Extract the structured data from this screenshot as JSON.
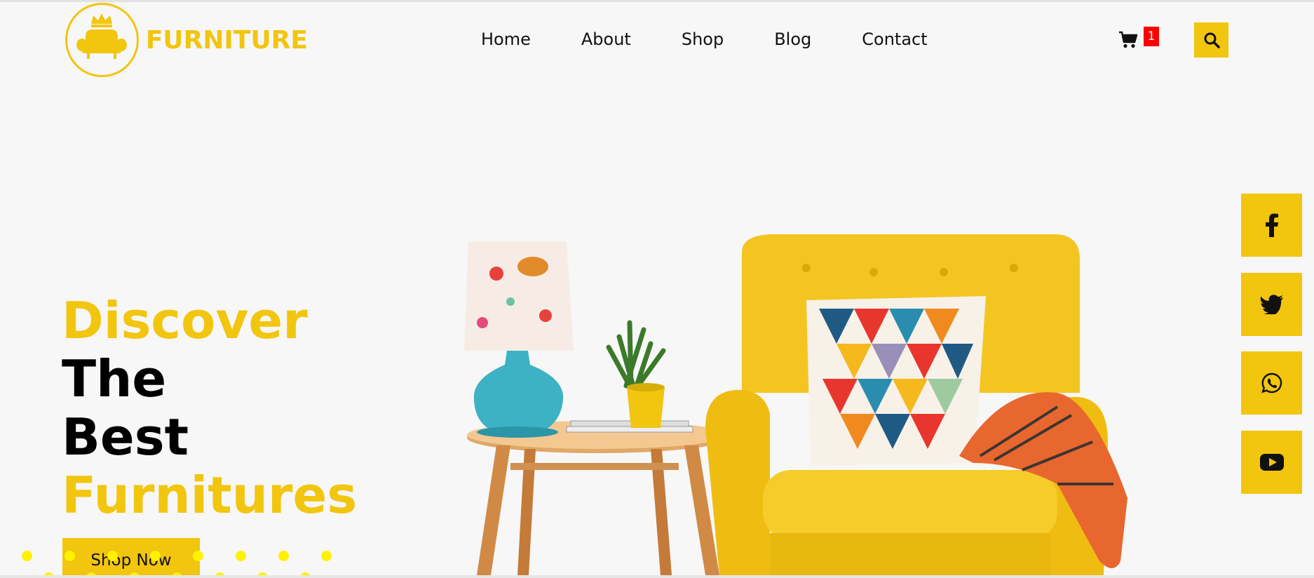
{
  "brand": {
    "name": "FURNITURE",
    "logo_icon": "armchair-crown-icon",
    "accent_color": "#f2c50f"
  },
  "nav": {
    "items": [
      "Home",
      "About",
      "Shop",
      "Blog",
      "Contact"
    ]
  },
  "cart": {
    "icon": "cart-icon",
    "count": "1",
    "badge_color": "#ff0000"
  },
  "search": {
    "icon": "search-icon"
  },
  "hero": {
    "line1": "Discover",
    "line2": "The",
    "line3": "Best",
    "line4": "Furnitures",
    "cta_label": "Shop Now"
  },
  "social": [
    {
      "name": "facebook",
      "icon": "facebook-icon"
    },
    {
      "name": "twitter",
      "icon": "twitter-icon"
    },
    {
      "name": "whatsapp",
      "icon": "whatsapp-icon"
    },
    {
      "name": "youtube",
      "icon": "youtube-icon"
    }
  ]
}
